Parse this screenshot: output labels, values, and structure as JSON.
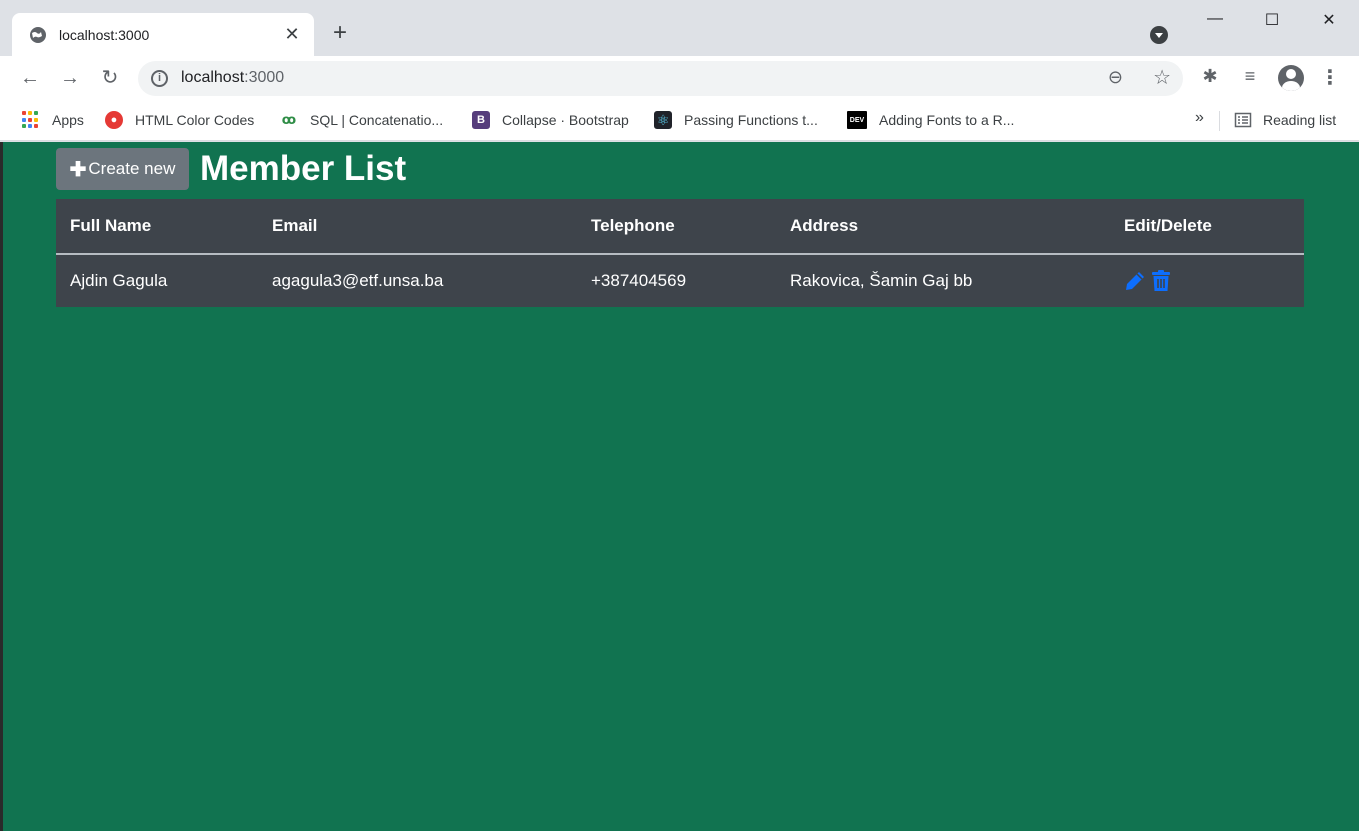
{
  "browser": {
    "tab_title": "localhost:3000",
    "new_tab": "+",
    "url_host": "localhost",
    "url_port": ":3000",
    "bookmarks": [
      {
        "label": "Apps"
      },
      {
        "label": "HTML Color Codes"
      },
      {
        "label": "SQL | Concatenatio..."
      },
      {
        "label": "Collapse · Bootstrap"
      },
      {
        "label": "Passing Functions t..."
      },
      {
        "label": "Adding Fonts to a R..."
      }
    ],
    "more": "»",
    "reading_list": "Reading list"
  },
  "page": {
    "create_button": "Create new",
    "title": "Member List",
    "columns": [
      "Full Name",
      "Email",
      "Telephone",
      "Address",
      "Edit/Delete"
    ],
    "rows": [
      {
        "full_name": "Ajdin Gagula",
        "email": "agagula3@etf.unsa.ba",
        "telephone": "+387404569",
        "address": "Rakovica, Šamin Gaj bb"
      }
    ]
  },
  "colors": {
    "page_background": "#117350",
    "table_background": "#3e444b",
    "button_secondary": "#6c757d",
    "action_icon": "#0d6efd"
  }
}
